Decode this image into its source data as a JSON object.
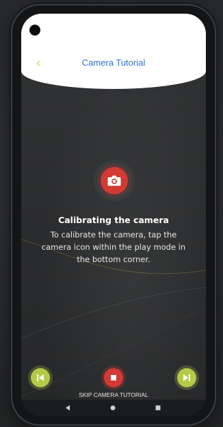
{
  "header": {
    "title": "Camera Tutorial",
    "back_icon": "back-arrow-icon"
  },
  "tutorial": {
    "icon": "camera-icon",
    "heading": "Calibrating the camera",
    "body": "To calibrate the camera, tap the camera icon within the play mode in the bottom corner."
  },
  "controls": {
    "prev_icon": "skip-previous-icon",
    "stop_icon": "stop-icon",
    "next_icon": "skip-next-icon",
    "skip_label": "SKIP CAMERA TUTORIAL"
  },
  "navigation": {
    "back_icon": "nav-back-icon",
    "home_icon": "nav-home-icon",
    "recent_icon": "nav-recent-icon"
  },
  "colors": {
    "accent_blue": "#2f6fd1",
    "accent_red": "#d23a33",
    "accent_green": "#b5c94a",
    "accent_yellow": "#e4c94a"
  }
}
